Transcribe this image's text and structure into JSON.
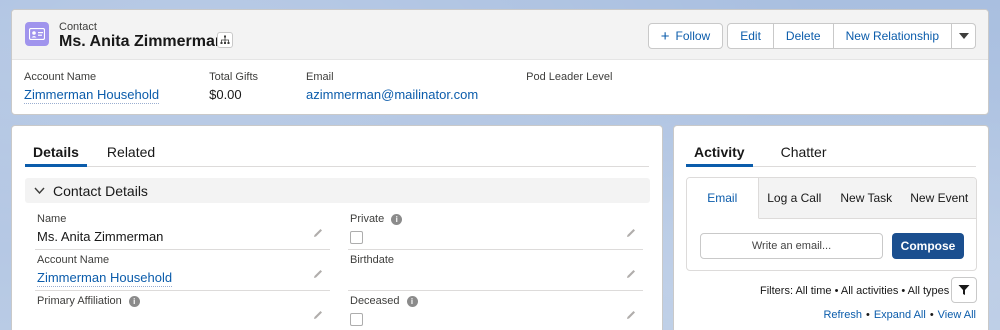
{
  "header": {
    "record_type": "Contact",
    "record_name": "Ms. Anita Zimmerman",
    "buttons": {
      "follow": "Follow",
      "edit": "Edit",
      "delete": "Delete",
      "new_relationship": "New Relationship"
    },
    "highlights": [
      {
        "label": "Account Name",
        "value": "Zimmerman Household"
      },
      {
        "label": "Total Gifts",
        "value": "$0.00"
      },
      {
        "label": "Email",
        "value": "azimmerman@mailinator.com"
      },
      {
        "label": "Pod Leader Level",
        "value": ""
      }
    ]
  },
  "details": {
    "tabs": [
      "Details",
      "Related"
    ],
    "section_title": "Contact Details",
    "fields": {
      "name": {
        "label": "Name",
        "value": "Ms. Anita Zimmerman"
      },
      "private": {
        "label": "Private",
        "checked": false
      },
      "account_name": {
        "label": "Account Name",
        "value": "Zimmerman Household"
      },
      "birthdate": {
        "label": "Birthdate",
        "value": ""
      },
      "primary_affiliation": {
        "label": "Primary Affiliation",
        "value": ""
      },
      "deceased": {
        "label": "Deceased",
        "checked": false
      }
    }
  },
  "activity": {
    "tabs": [
      "Activity",
      "Chatter"
    ],
    "publisher_tabs": [
      "Email",
      "Log a Call",
      "New Task",
      "New Event"
    ],
    "email_placeholder": "Write an email...",
    "compose_label": "Compose",
    "filters_text": "Filters: All time • All activities • All types",
    "links": [
      "Refresh",
      "Expand All",
      "View All"
    ]
  },
  "colors": {
    "brand_link": "#0b5cab",
    "compose_bg": "#1b4f8f",
    "contact_icon": "#a094ed",
    "page_bg": "#b0c4df"
  }
}
